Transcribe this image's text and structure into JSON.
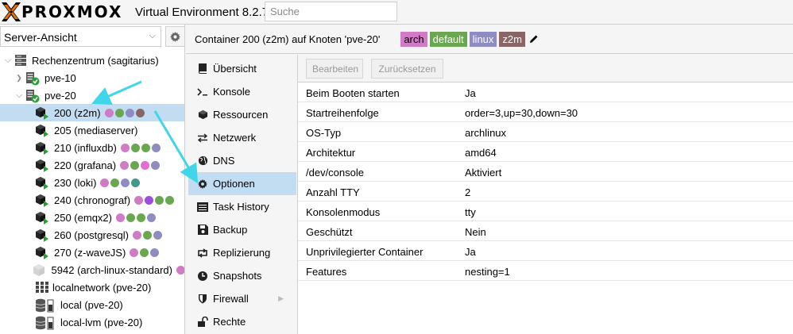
{
  "app": {
    "brand": "PROXMOX",
    "version": "Virtual Environment 8.2.7",
    "search_placeholder": "Suche"
  },
  "colors": {
    "brand_orange": "#e57000",
    "selection": "#c2ddf2",
    "running_green": "#22a42c",
    "ok_green": "#2a9d39"
  },
  "left": {
    "view_select": "Server-Ansicht",
    "tree": [
      {
        "label": "Rechenzentrum (sagitarius)",
        "level": 0,
        "icon": "datacenter-icon",
        "expander": "collapse"
      },
      {
        "label": "pve-10",
        "level": 1,
        "icon": "node-online-icon",
        "expander": "expand"
      },
      {
        "label": "pve-20",
        "level": 1,
        "icon": "node-online-icon",
        "expander": "collapse"
      },
      {
        "label": "200 (z2m)",
        "level": 2,
        "icon": "container-running-icon",
        "selected": true,
        "tags": [
          "#d17ac5",
          "#6aa84f",
          "#8e8cc2",
          "#8a6565"
        ]
      },
      {
        "label": "205 (mediaserver)",
        "level": 2,
        "icon": "container-running-icon",
        "tags": []
      },
      {
        "label": "210 (influxdb)",
        "level": 2,
        "icon": "container-running-icon",
        "tags": [
          "#d17ac5",
          "#6aa84f",
          "#6aa84f",
          "#8e8cc2"
        ]
      },
      {
        "label": "220 (grafana)",
        "level": 2,
        "icon": "container-running-icon",
        "tags": [
          "#d17ac5",
          "#6aa84f",
          "#e86ad6",
          "#8e8cc2"
        ]
      },
      {
        "label": "230 (loki)",
        "level": 2,
        "icon": "container-running-icon",
        "tags": [
          "#d17ac5",
          "#6aa84f",
          "#8e8cc2",
          "#3c9a8e"
        ]
      },
      {
        "label": "240 (chronograf)",
        "level": 2,
        "icon": "container-running-icon",
        "tags": [
          "#d17ac5",
          "#9d4edd",
          "#6aa84f",
          "#6aa84f"
        ]
      },
      {
        "label": "250 (emqx2)",
        "level": 2,
        "icon": "container-running-icon",
        "tags": [
          "#d17ac5",
          "#6aa84f",
          "#6aa84f",
          "#8e8cc2"
        ]
      },
      {
        "label": "260 (postgresql)",
        "level": 2,
        "icon": "container-running-icon",
        "tags": [
          "#d17ac5",
          "#6aa84f",
          "#8e8cc2"
        ]
      },
      {
        "label": "270 (z-waveJS)",
        "level": 2,
        "icon": "container-running-icon",
        "tags": [
          "#d17ac5",
          "#6aa84f",
          "#8e8cc2"
        ]
      },
      {
        "label": "5942 (arch-linux-standard)",
        "level": 2,
        "icon": "container-template-icon",
        "tags": [
          "#d17ac5"
        ]
      },
      {
        "label": "localnetwork (pve-20)",
        "level": 2,
        "icon": "network-icon",
        "tags": []
      },
      {
        "label": "local (pve-20)",
        "level": 2,
        "icon": "storage-icon",
        "tags": []
      },
      {
        "label": "local-lvm (pve-20)",
        "level": 2,
        "icon": "storage-icon",
        "tags": []
      }
    ]
  },
  "header": {
    "title": "Container 200 (z2m) auf Knoten 'pve-20'",
    "tags": [
      {
        "label": "arch",
        "color": "#d17ac5",
        "text_color": "#000000"
      },
      {
        "label": "default",
        "color": "#6aa84f",
        "text_color": "#ffffff"
      },
      {
        "label": "linux",
        "color": "#8e8cc2",
        "text_color": "#ffffff"
      },
      {
        "label": "z2m",
        "color": "#8a6565",
        "text_color": "#ffffff"
      }
    ]
  },
  "nav": [
    {
      "label": "Übersicht",
      "icon": "book-icon"
    },
    {
      "label": "Konsole",
      "icon": "terminal-icon"
    },
    {
      "label": "Ressourcen",
      "icon": "cube-icon"
    },
    {
      "label": "Netzwerk",
      "icon": "exchange-icon"
    },
    {
      "label": "DNS",
      "icon": "globe-icon"
    },
    {
      "label": "Optionen",
      "icon": "gear-icon",
      "active": true
    },
    {
      "label": "Task History",
      "icon": "list-icon"
    },
    {
      "label": "Backup",
      "icon": "floppy-icon"
    },
    {
      "label": "Replizierung",
      "icon": "retweet-icon"
    },
    {
      "label": "Snapshots",
      "icon": "history-icon"
    },
    {
      "label": "Firewall",
      "icon": "shield-icon",
      "submenu": true
    },
    {
      "label": "Rechte",
      "icon": "unlock-icon"
    }
  ],
  "toolbar": {
    "edit_label": "Bearbeiten",
    "reset_label": "Zurücksetzen"
  },
  "options": [
    {
      "key": "Beim Booten starten",
      "value": "Ja"
    },
    {
      "key": "Startreihenfolge",
      "value": "order=3,up=30,down=30"
    },
    {
      "key": "OS-Typ",
      "value": "archlinux"
    },
    {
      "key": "Architektur",
      "value": "amd64"
    },
    {
      "key": "/dev/console",
      "value": "Aktiviert"
    },
    {
      "key": "Anzahl TTY",
      "value": "2"
    },
    {
      "key": "Konsolenmodus",
      "value": "tty"
    },
    {
      "key": "Geschützt",
      "value": "Nein"
    },
    {
      "key": "Unprivilegierter Container",
      "value": "Ja"
    },
    {
      "key": "Features",
      "value": "nesting=1"
    }
  ]
}
